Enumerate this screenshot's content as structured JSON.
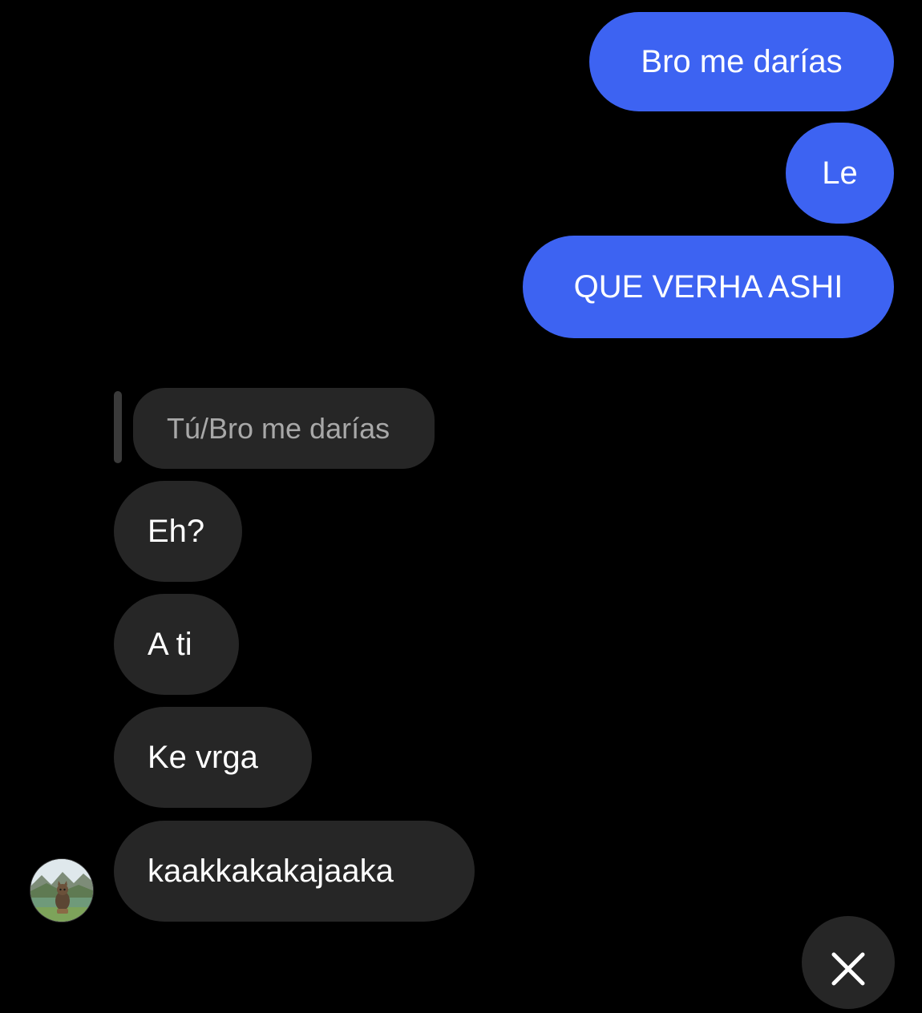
{
  "sent_messages": [
    {
      "text": "Bro me darías"
    },
    {
      "text": "Le"
    },
    {
      "text": "QUE VERHA ASHI"
    }
  ],
  "reply": {
    "quote": "Tú/Bro me darías"
  },
  "received_messages": [
    {
      "text": "Eh?"
    },
    {
      "text": "A ti"
    },
    {
      "text": "Ke vrga"
    },
    {
      "text": "kaakkakakajaaka"
    }
  ],
  "contact": {
    "avatar_icon": "cat-landscape-avatar"
  },
  "scroll_button": {
    "icon": "close-icon"
  },
  "colors": {
    "background": "#000000",
    "sent_bubble": "#3d63f2",
    "received_bubble": "#262626",
    "quote_text": "#a8a8a8"
  }
}
